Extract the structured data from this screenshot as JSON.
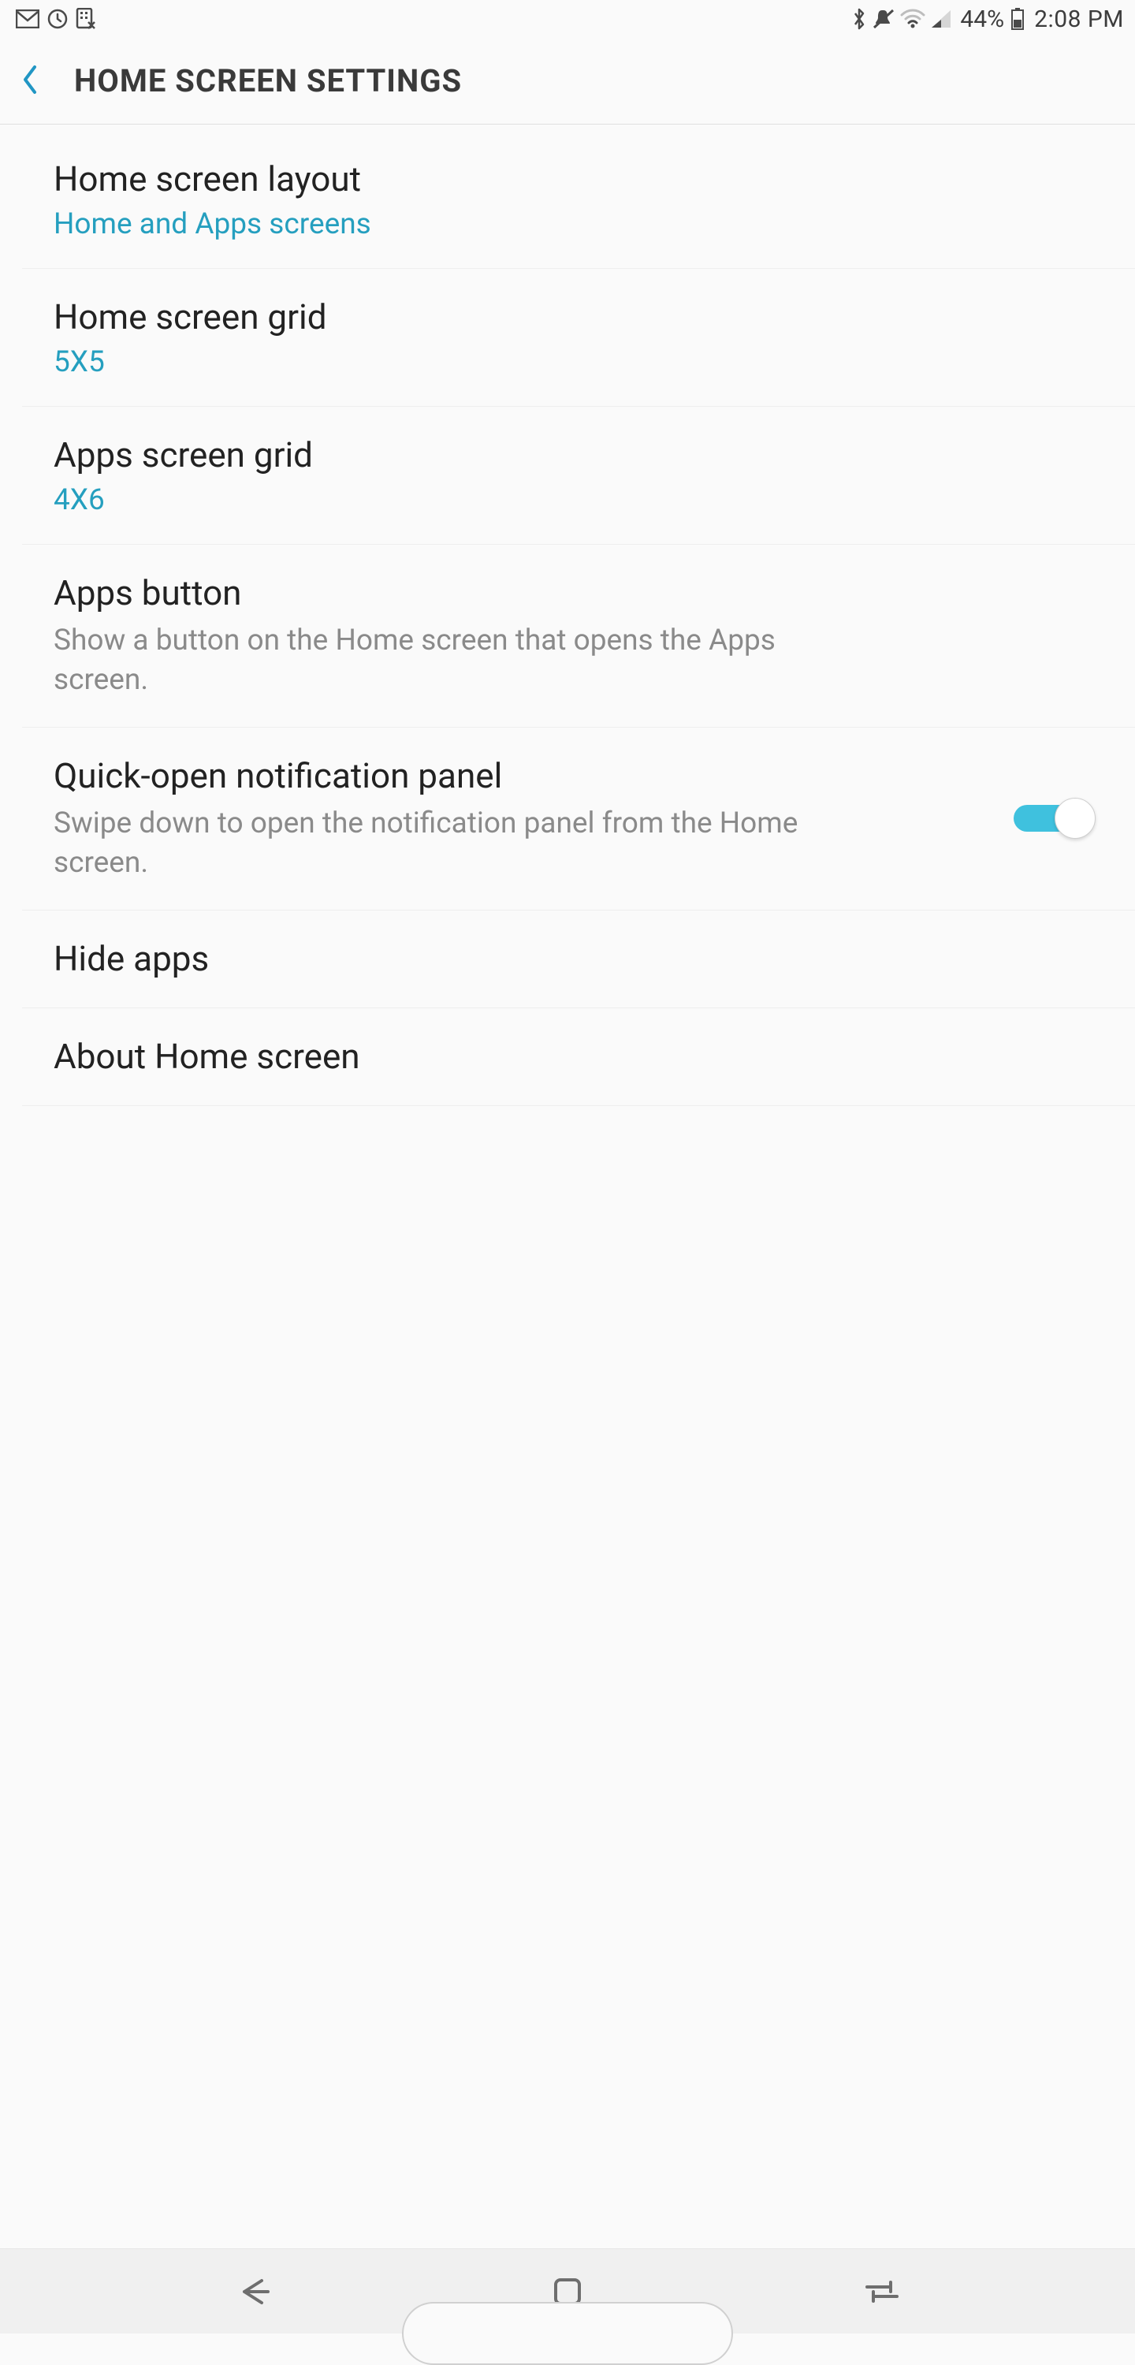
{
  "status": {
    "battery_pct": "44%",
    "time": "2:08 PM",
    "icons_left": [
      "gmail",
      "clock",
      "app-blocked"
    ],
    "icons_right": [
      "bluetooth",
      "mute",
      "wifi",
      "cell-signal",
      "battery"
    ]
  },
  "header": {
    "title": "HOME SCREEN SETTINGS"
  },
  "items": [
    {
      "title": "Home screen layout",
      "sub": "Home and Apps screens",
      "sub_style": "accent"
    },
    {
      "title": "Home screen grid",
      "sub": "5X5",
      "sub_style": "accent"
    },
    {
      "title": "Apps screen grid",
      "sub": "4X6",
      "sub_style": "accent"
    },
    {
      "title": "Apps button",
      "sub": "Show a button on the Home screen that opens the Apps screen.",
      "sub_style": "gray"
    },
    {
      "title": "Quick-open notification panel",
      "sub": "Swipe down to open the notification panel from the Home screen.",
      "sub_style": "gray",
      "toggle": true,
      "toggle_on": true
    },
    {
      "title": "Hide apps"
    },
    {
      "title": "About Home screen"
    }
  ],
  "nav": {
    "buttons": [
      "back",
      "home",
      "recent"
    ]
  },
  "colors": {
    "accent": "#259fbf",
    "toggle_on": "#3fc1de"
  }
}
